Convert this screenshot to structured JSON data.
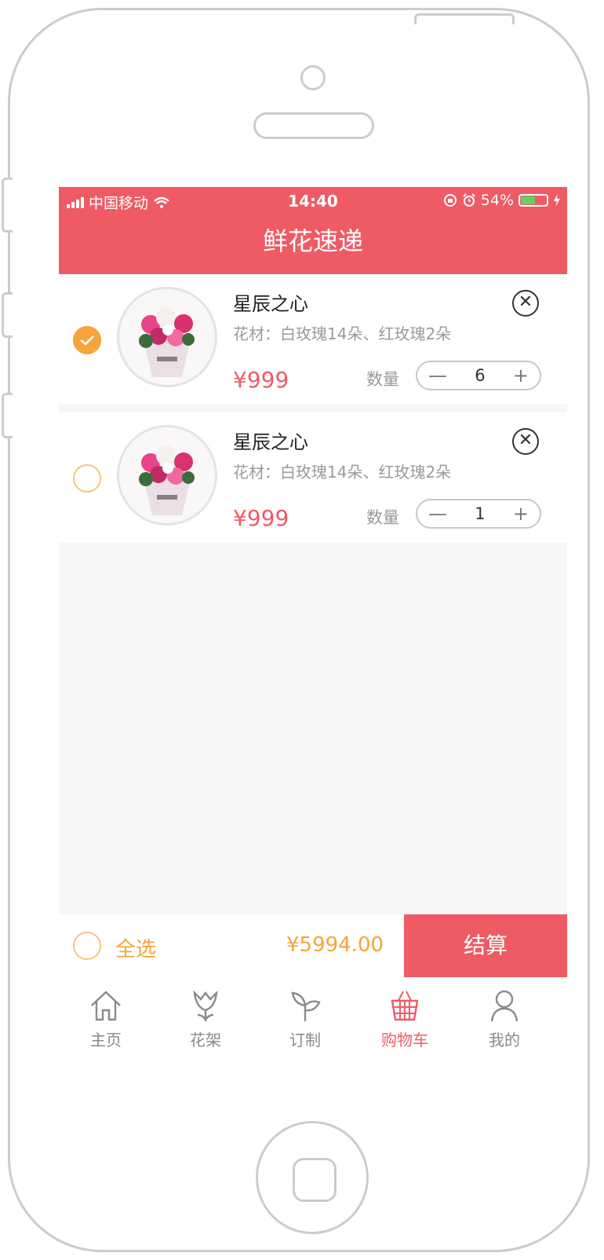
{
  "status_bar": {
    "carrier": "中国移动",
    "time": "14:40",
    "battery_percent": "54%",
    "battery_level": 0.54,
    "icons": [
      "signal-icon",
      "wifi-icon",
      "lock-rotation-icon",
      "alarm-icon",
      "battery-icon",
      "charging-icon"
    ]
  },
  "header": {
    "title": "鲜花速递"
  },
  "cart": {
    "items": [
      {
        "name": "星辰之心",
        "materials": "花材：白玫瑰14朵、红玫瑰2朵",
        "price": "¥999",
        "quantity_label": "数量",
        "minus": "—",
        "quantity": "6",
        "plus": "+",
        "selected": true
      },
      {
        "name": "星辰之心",
        "materials": "花材：白玫瑰14朵、红玫瑰2朵",
        "price": "¥999",
        "quantity_label": "数量",
        "minus": "—",
        "quantity": "1",
        "plus": "+",
        "selected": false
      }
    ]
  },
  "checkout": {
    "select_all_label": "全选",
    "total": "¥5994.00",
    "settle_label": "结算"
  },
  "tabs": [
    {
      "label": "主页",
      "icon": "home-icon",
      "active": false
    },
    {
      "label": "花架",
      "icon": "tulip-icon",
      "active": false
    },
    {
      "label": "订制",
      "icon": "sprout-icon",
      "active": false
    },
    {
      "label": "购物车",
      "icon": "basket-icon",
      "active": true
    },
    {
      "label": "我的",
      "icon": "person-icon",
      "active": false
    }
  ],
  "colors": {
    "brand": "#ef5b64",
    "accent": "#f5a53a",
    "muted": "#9a9a9a"
  }
}
